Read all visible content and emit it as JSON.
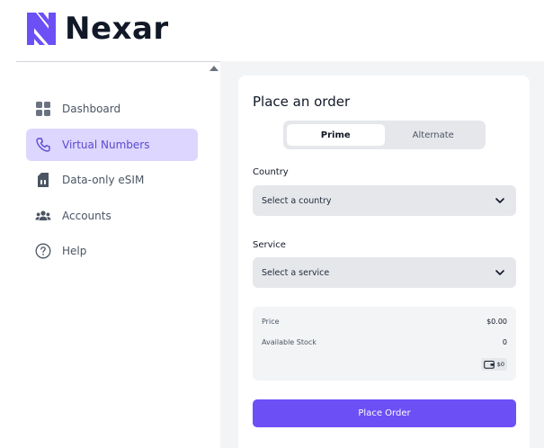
{
  "brand": {
    "name": "Nexar",
    "accent": "#5b4bd0"
  },
  "sidebar": {
    "items": [
      {
        "label": "Dashboard",
        "icon": "grid-icon",
        "active": false
      },
      {
        "label": "Virtual Numbers",
        "icon": "phone-icon",
        "active": true
      },
      {
        "label": "Data-only eSIM",
        "icon": "sim-card-icon",
        "active": false
      },
      {
        "label": "Accounts",
        "icon": "users-icon",
        "active": false
      },
      {
        "label": "Help",
        "icon": "help-circle-icon",
        "active": false
      }
    ]
  },
  "order": {
    "title": "Place an order",
    "tabs": [
      {
        "label": "Prime",
        "active": true
      },
      {
        "label": "Alternate",
        "active": false
      }
    ],
    "country": {
      "label": "Country",
      "placeholder": "Select a country"
    },
    "service": {
      "label": "Service",
      "placeholder": "Select a service"
    },
    "summary": {
      "price_label": "Price",
      "price_value": "$0.00",
      "stock_label": "Available Stock",
      "stock_value": "0",
      "balance": "$0"
    },
    "submit_label": "Place Order",
    "button_color": "#6d4ff6"
  }
}
